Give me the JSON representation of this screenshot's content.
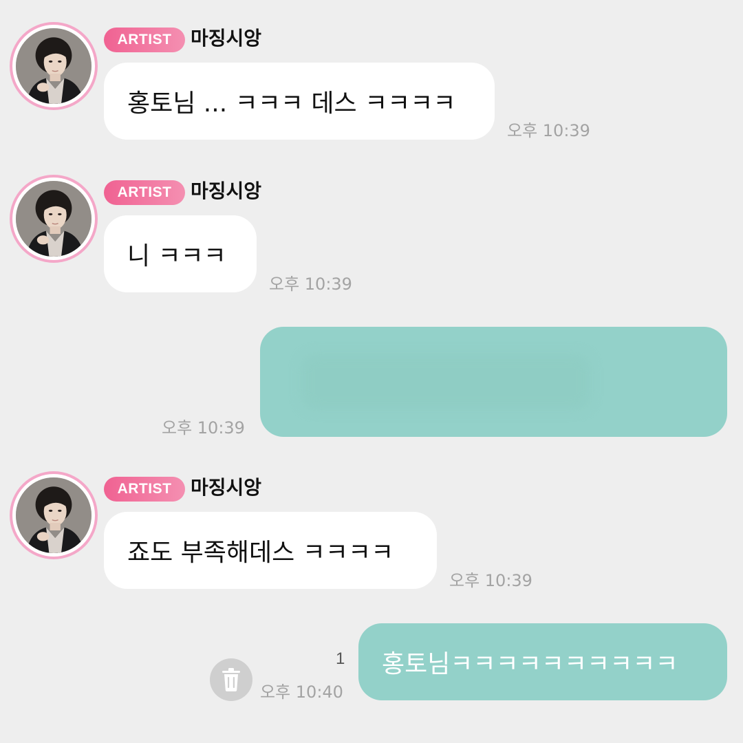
{
  "messages": [
    {
      "sender": {
        "badge": "ARTIST",
        "name": "마징시앙"
      },
      "text": "홍토님 ... ㅋㅋㅋ 데스 ㅋㅋㅋㅋ",
      "time": "오후 10:39"
    },
    {
      "sender": {
        "badge": "ARTIST",
        "name": "마징시앙"
      },
      "text": "니 ㅋㅋㅋ",
      "time": "오후 10:39"
    },
    {
      "outgoing": true,
      "text": "",
      "time": "오후 10:39"
    },
    {
      "sender": {
        "badge": "ARTIST",
        "name": "마징시앙"
      },
      "text": "죠도 부족해데스 ㅋㅋㅋㅋ",
      "time": "오후 10:39"
    },
    {
      "outgoing": true,
      "text": "홍토님ㅋㅋㅋㅋㅋㅋㅋㅋㅋㅋ",
      "time": "오후 10:40",
      "unread_count": "1"
    }
  ],
  "colors": {
    "background": "#eeeeee",
    "incoming_bubble": "#ffffff",
    "outgoing_bubble": "#93d1c9",
    "badge": "#f06292",
    "avatar_ring": "#f4a7c8",
    "timestamp": "#a3a3a3"
  },
  "icons": {
    "delete": "trash-icon",
    "avatar": "profile-photo"
  }
}
